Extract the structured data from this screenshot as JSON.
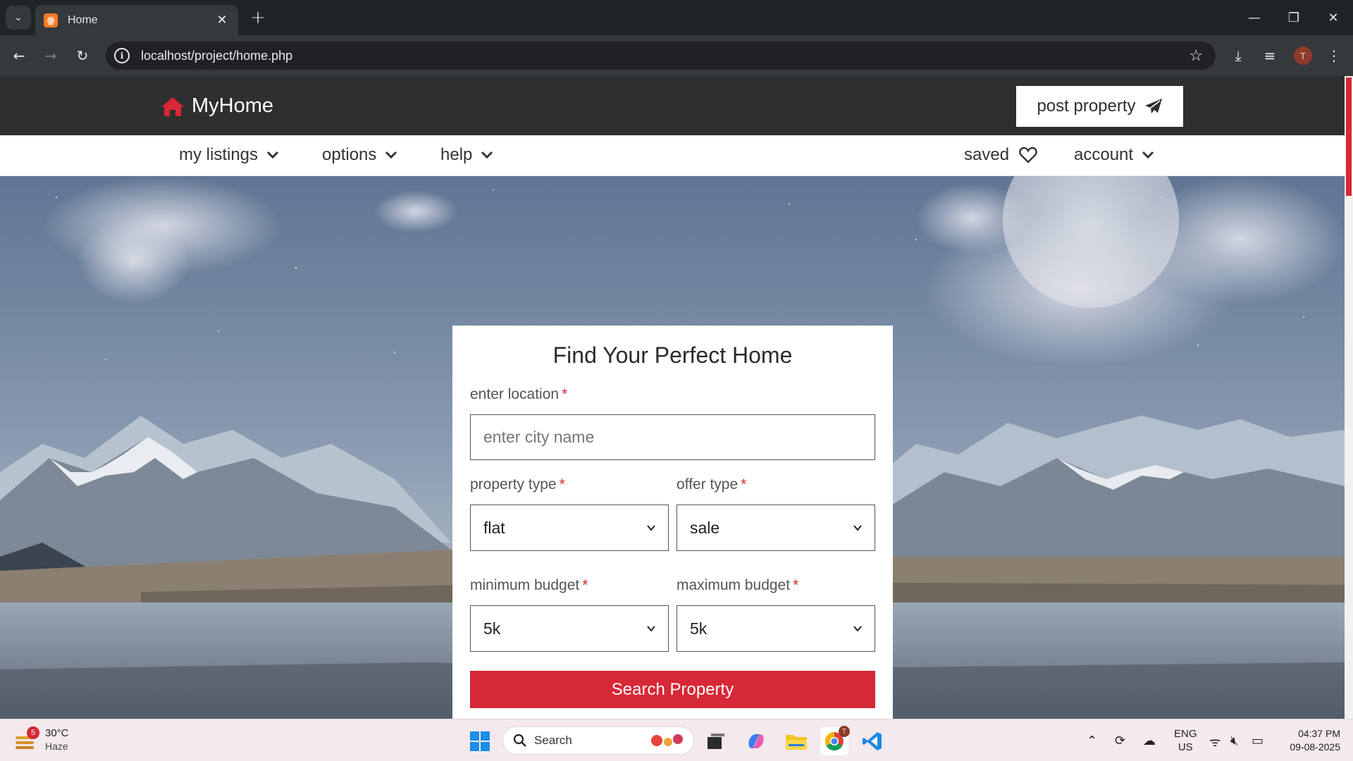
{
  "browser": {
    "tab_title": "Home",
    "url": "localhost/project/home.php",
    "profile_initial": "T"
  },
  "header": {
    "logo_text": "MyHome",
    "post_button_label": "post property",
    "accent_color": "#d62836"
  },
  "nav": {
    "my_listings": "my listings",
    "options": "options",
    "help": "help",
    "saved": "saved",
    "account": "account"
  },
  "search_form": {
    "title": "Find Your Perfect Home",
    "location_label": "enter location",
    "location_placeholder": "enter city name",
    "property_type_label": "property type",
    "property_type_value": "flat",
    "offer_type_label": "offer type",
    "offer_type_value": "sale",
    "min_budget_label": "minimum budget",
    "min_budget_value": "5k",
    "max_budget_label": "maximum budget",
    "max_budget_value": "5k",
    "required_marker": "*",
    "submit_label": "Search Property"
  },
  "taskbar": {
    "weather_badge": "5",
    "weather_temp": "30°C",
    "weather_condition": "Haze",
    "search_placeholder": "Search",
    "chrome_badge": "T",
    "lang_line1": "ENG",
    "lang_line2": "US",
    "time": "04:37 PM",
    "date": "09-08-2025"
  }
}
